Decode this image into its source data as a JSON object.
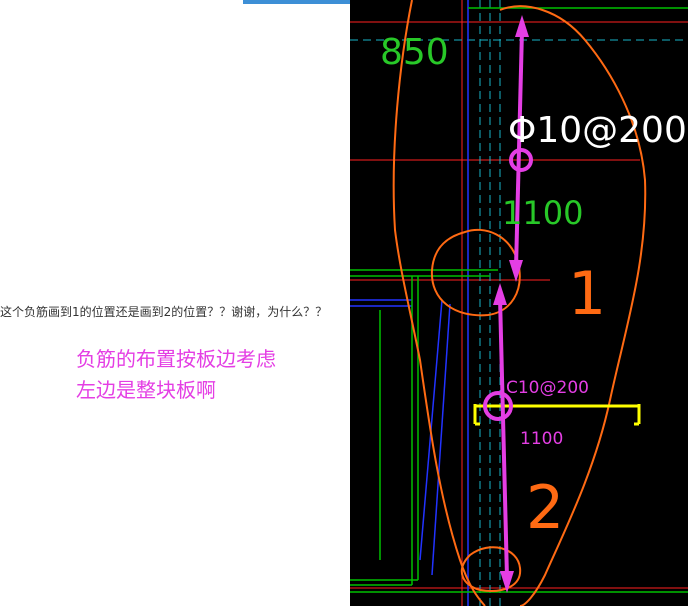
{
  "question_text": "这个负筋画到1的位置还是画到2的位置？？谢谢，为什么？？",
  "answer_lines": [
    "负筋的布置按板边考虑",
    "左边是整块板啊"
  ],
  "drawing": {
    "dim_top": "850",
    "rebar_upper": "Φ10@200",
    "length_upper": "1100",
    "rebar_lower": "C10@200",
    "length_lower": "1100",
    "mark_1": "1",
    "mark_2": "2"
  },
  "colors": {
    "cad_background": "#000000",
    "annotation_orange": "#ff6a13",
    "annotation_magenta": "#e43ee4",
    "rebar_yellow": "#ffff00",
    "dimension_green": "#28c828",
    "wall_green": "#00c000",
    "line_red": "#ff2020",
    "line_blue": "#2233ff",
    "line_cyan": "#18b4c8"
  }
}
